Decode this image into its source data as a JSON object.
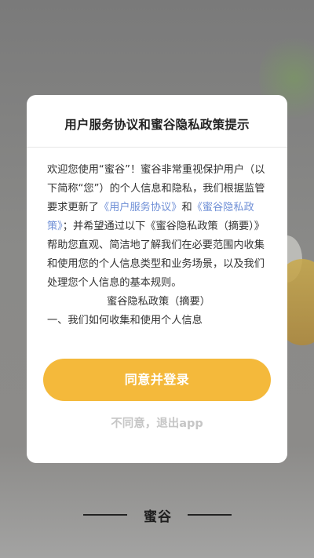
{
  "dialog": {
    "title": "用户服务协议和蜜谷隐私政策提示",
    "body": {
      "p1": "欢迎您使用“蜜谷”！蜜谷非常重视保护用户（以下简称“您”）的个人信息和隐私，我们根据监管要求更新了",
      "link_service": "《用户服务协议》",
      "and": "和",
      "link_privacy": "《蜜谷隐私政策》",
      "p2": "；并希望通过以下《蜜谷隐私政策（摘要）》帮助您直观、简洁地了解我们在必要范围内收集和使用您的个人信息类型和业务场景，以及我们处理您个人信息的基本规则。",
      "summary_heading": "蜜谷隐私政策（摘要）",
      "section_1": "一、我们如何收集和使用个人信息"
    },
    "agree_button": "同意并登录",
    "disagree_button": "不同意，退出app"
  },
  "brand": {
    "name": "蜜谷"
  },
  "colors": {
    "accent": "#f4b93b",
    "link": "#6f8fd6",
    "overlay": "#7c7c7c"
  }
}
